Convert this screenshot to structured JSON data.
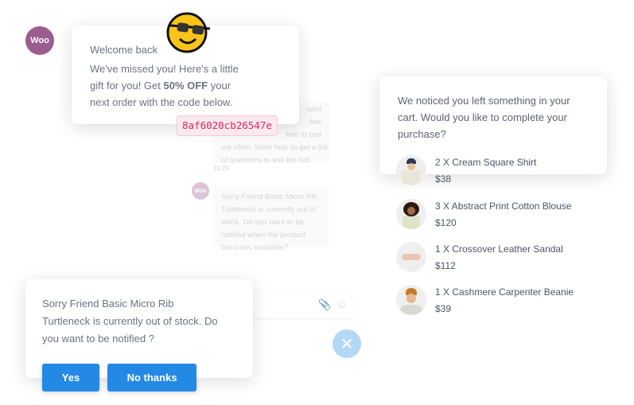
{
  "bg_chat": {
    "bubble1_lines": [
      "oard",
      "Ask",
      "free to test",
      "me often. Write help to get a list",
      "of questions to ask the bot."
    ],
    "time": "11:29",
    "avatar": "Woo",
    "bubble2": "Sorry Friend Basic Micro Rib Turtleneck is currently out of stock. Do you want to be notified when the product becomes available?",
    "input_icons": [
      "paperclip-icon",
      "smiley-icon"
    ]
  },
  "welcome": {
    "avatar": "Woo",
    "title": "Welcome back",
    "text_before": "We've missed you! Here's a little gift for you! Get ",
    "bold": "50% OFF",
    "text_after": " your next order with the code below.",
    "code": "8af6020cb26547e"
  },
  "cart": {
    "message": "We noticed you left something in your cart. Would you like to complete your purchase?",
    "items": [
      {
        "name": "2 X Cream Square Shirt",
        "price": "$38"
      },
      {
        "name": "3 X Abstract Print Cotton Blouse",
        "price": "$120"
      },
      {
        "name": "1 X Crossover Leather Sandal",
        "price": "$112"
      },
      {
        "name": "1 X Cashmere Carpenter Beanie",
        "price": "$39"
      }
    ]
  },
  "stock": {
    "message": "Sorry Friend Basic Micro Rib Turtleneck is currently out of stock. Do you want to be notified ?",
    "yes": "Yes",
    "no": "No thanks"
  },
  "colors": {
    "brand": "#9b5c8f",
    "button": "#2389e5",
    "code": "#e0245e",
    "close": "#b3d7f7"
  }
}
